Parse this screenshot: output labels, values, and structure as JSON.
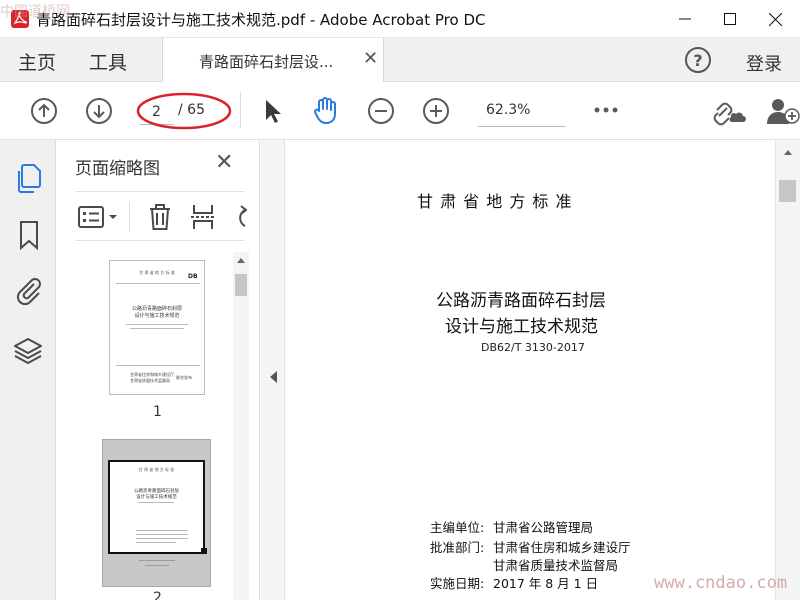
{
  "window": {
    "title": "青路面碎石封层设计与施工技术规范.pdf - Adobe Acrobat Pro DC"
  },
  "menubar": {
    "home": "主页",
    "tools": "工具",
    "doc_tab": "青路面碎石封层设...",
    "login": "登录"
  },
  "toolbar": {
    "page_current": "2",
    "page_total": "/ 65",
    "zoom": "62.3%"
  },
  "panel": {
    "title": "页面缩略图",
    "thumbs": [
      {
        "label": "1"
      },
      {
        "label": "2"
      }
    ]
  },
  "document": {
    "standard_header": "甘 肃 省 地 方 标 准",
    "title_line1": "公路沥青路面碎石封层",
    "title_line2": "设计与施工技术规范",
    "code": "DB62/T 3130-2017",
    "editor_label": "主编单位:",
    "editor_value": "甘肃省公路管理局",
    "approver_label": "批准部门:",
    "approver_value1": "甘肃省住房和城乡建设厅",
    "approver_value2": "甘肃省质量技术监督局",
    "date_label": "实施日期:",
    "date_value": "2017 年 8 月 1 日"
  },
  "thumb1": {
    "header": "甘 肃 省 地 方 标 准",
    "badge": "DB",
    "title1": "公路沥青路面碎石封层",
    "title2": "设计与施工技术规范",
    "issuer1": "甘肃省住房和城乡建设厅",
    "issuer2": "甘肃省质量技术监督局",
    "issue_tag": "联合发布"
  },
  "thumb2": {
    "header": "甘 肃 省 地 方 标 准",
    "title1": "公路沥青路面碎石封层",
    "title2": "设计与施工技术规范"
  },
  "watermarks": {
    "top_left": "中国道桥网",
    "bottom_right": "www.cndao.com"
  },
  "colors": {
    "accent_blue": "#2a7ae2",
    "annotation_red": "#d9232a",
    "icon_gray": "#5a5a5a"
  }
}
